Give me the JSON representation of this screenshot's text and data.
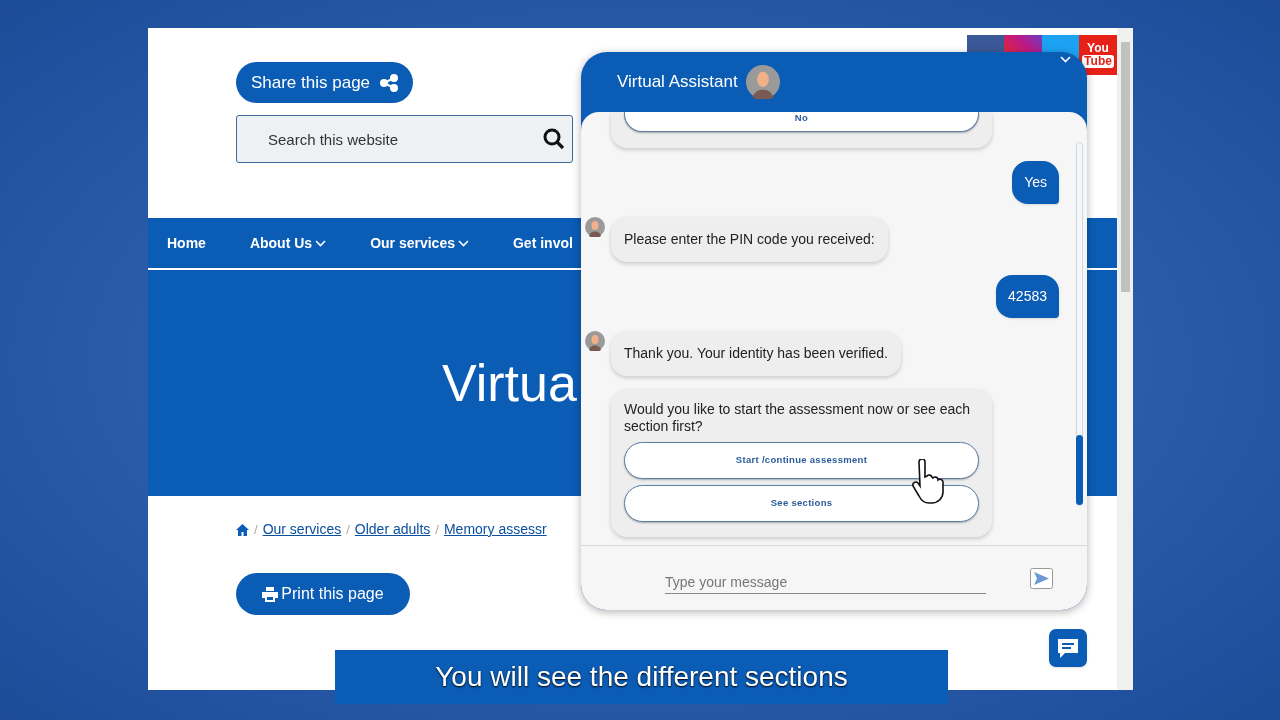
{
  "page": {
    "share_button": "Share this page",
    "search": {
      "placeholder": "Search this website"
    },
    "nav": [
      {
        "label": "Home",
        "dropdown": false
      },
      {
        "label": "About Us",
        "dropdown": true
      },
      {
        "label": "Our services",
        "dropdown": true
      },
      {
        "label": "Get invol",
        "dropdown": false
      }
    ],
    "hero_title": "Virtua",
    "breadcrumb": [
      {
        "separator": "/",
        "label": "Our services"
      },
      {
        "separator": "/",
        "label": "Older adults"
      },
      {
        "separator": "/",
        "label": "Memory assessr"
      }
    ],
    "print_button": "Print this page",
    "social": {
      "youtube": [
        "You",
        "Tube"
      ]
    }
  },
  "chat": {
    "title": "Virtual Assistant",
    "messages": [
      {
        "kind": "partial_options",
        "avatar": false,
        "options": [
          "No"
        ]
      },
      {
        "kind": "user_text",
        "text": "Yes"
      },
      {
        "kind": "bot_text",
        "avatar": true,
        "text": "Please enter the PIN code you received:"
      },
      {
        "kind": "user_text",
        "text": "42583"
      },
      {
        "kind": "bot_text",
        "avatar": true,
        "text": "Thank you. Your identity has been verified."
      },
      {
        "kind": "options",
        "avatar": false,
        "text": "Would you like to start the assessment now or see each section first?",
        "options": [
          "Start /continue assessment",
          "See sections"
        ]
      }
    ],
    "input": {
      "placeholder": "Type your message"
    }
  },
  "caption": "You will see the different sections"
}
